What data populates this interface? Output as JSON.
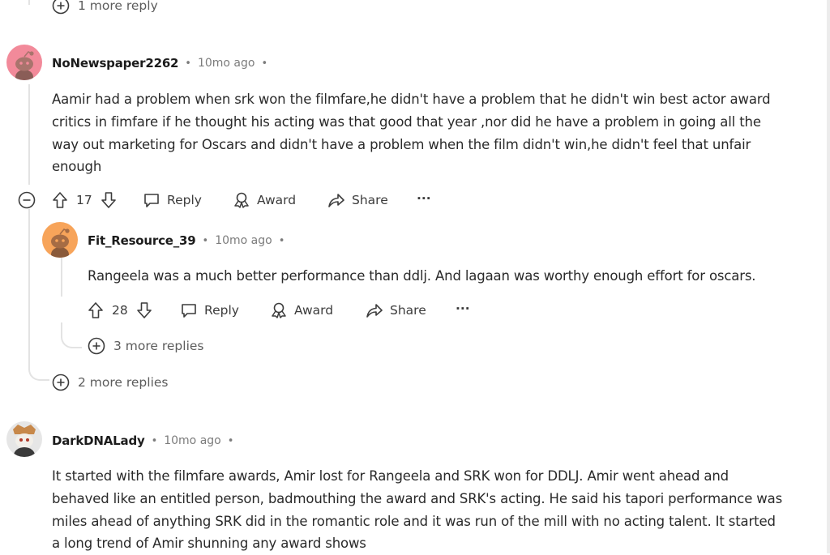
{
  "previous": {
    "more_replies": "1 more reply"
  },
  "comments": [
    {
      "username": "NoNewspaper2262",
      "dot": "•",
      "time": "10mo ago",
      "dot2": "•",
      "body_lines": [
        "Aamir had a problem when srk won the filmfare,he didn't have a problem that he didn't win best actor award",
        "critics in fimfare if he thought his acting was that good that year ,nor did he have a problem in going all the",
        "way out marketing for Oscars and didn't have a problem when the film didn't win,he didn't feel that unfair",
        "enough"
      ],
      "votes": "17",
      "reply": "Reply",
      "award": "Award",
      "share": "Share",
      "more": "···",
      "avatar_color": "#f28a9a",
      "more_replies": "2 more replies",
      "reply_comment": {
        "username": "Fit_Resource_39",
        "dot": "•",
        "time": "10mo ago",
        "dot2": "•",
        "body": "Rangeela was a much better performance than ddlj. And lagaan was worthy enough effort for oscars.",
        "votes": "28",
        "reply": "Reply",
        "award": "Award",
        "share": "Share",
        "more": "···",
        "avatar_color": "#f7a45a",
        "more_replies": "3 more replies"
      }
    },
    {
      "username": "DarkDNALady",
      "dot": "•",
      "time": "10mo ago",
      "dot2": "•",
      "body_lines": [
        "It started with the filmfare awards, Amir lost for Rangeela and SRK won for DDLJ. Amir went ahead and",
        "behaved like an entitled person, badmouthing the award and SRK's acting. He said his tapori performance was",
        "miles ahead of anything SRK did in the romantic role and it was run of the mill with no acting talent. It started",
        "a long trend of Amir shunning any award shows"
      ]
    }
  ]
}
